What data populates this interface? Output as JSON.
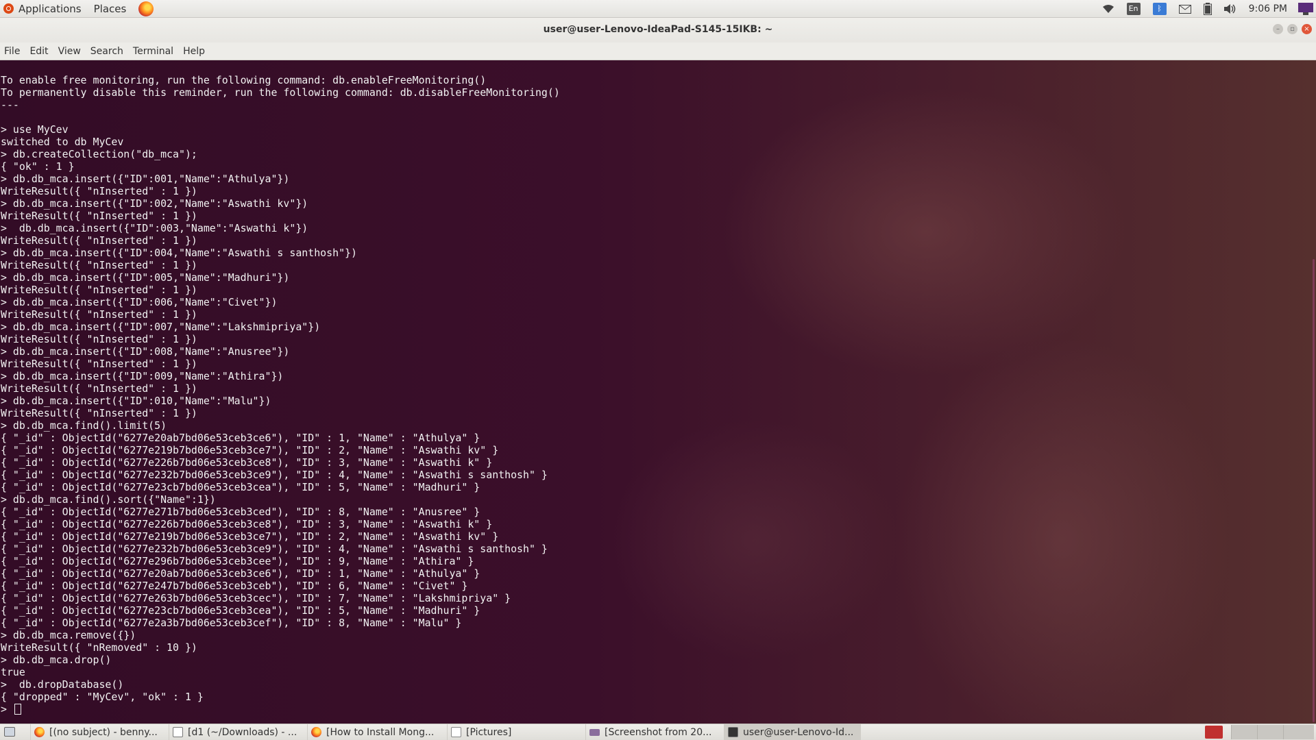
{
  "top_panel": {
    "applications_label": "Applications",
    "places_label": "Places",
    "tray": {
      "wifi_icon": "wifi-icon",
      "keyboard_layout": "En",
      "bluetooth_icon": "bluetooth-icon",
      "mail_icon": "mail-icon",
      "battery_icon": "battery-icon",
      "volume_icon": "volume-icon",
      "clock": "9:06 PM"
    }
  },
  "window": {
    "title": "user@user-Lenovo-IdeaPad-S145-15IKB: ~"
  },
  "menubar": {
    "items": [
      "File",
      "Edit",
      "View",
      "Search",
      "Terminal",
      "Help"
    ]
  },
  "terminal": {
    "lines": [
      "To enable free monitoring, run the following command: db.enableFreeMonitoring()",
      "To permanently disable this reminder, run the following command: db.disableFreeMonitoring()",
      "---",
      "",
      "> use MyCev",
      "switched to db MyCev",
      "> db.createCollection(\"db_mca\");",
      "{ \"ok\" : 1 }",
      "> db.db_mca.insert({\"ID\":001,\"Name\":\"Athulya\"})",
      "WriteResult({ \"nInserted\" : 1 })",
      "> db.db_mca.insert({\"ID\":002,\"Name\":\"Aswathi kv\"})",
      "WriteResult({ \"nInserted\" : 1 })",
      ">  db.db_mca.insert({\"ID\":003,\"Name\":\"Aswathi k\"})",
      "WriteResult({ \"nInserted\" : 1 })",
      "> db.db_mca.insert({\"ID\":004,\"Name\":\"Aswathi s santhosh\"})",
      "WriteResult({ \"nInserted\" : 1 })",
      "> db.db_mca.insert({\"ID\":005,\"Name\":\"Madhuri\"})",
      "WriteResult({ \"nInserted\" : 1 })",
      "> db.db_mca.insert({\"ID\":006,\"Name\":\"Civet\"})",
      "WriteResult({ \"nInserted\" : 1 })",
      "> db.db_mca.insert({\"ID\":007,\"Name\":\"Lakshmipriya\"})",
      "WriteResult({ \"nInserted\" : 1 })",
      "> db.db_mca.insert({\"ID\":008,\"Name\":\"Anusree\"})",
      "WriteResult({ \"nInserted\" : 1 })",
      "> db.db_mca.insert({\"ID\":009,\"Name\":\"Athira\"})",
      "WriteResult({ \"nInserted\" : 1 })",
      "> db.db_mca.insert({\"ID\":010,\"Name\":\"Malu\"})",
      "WriteResult({ \"nInserted\" : 1 })",
      "> db.db_mca.find().limit(5)",
      "{ \"_id\" : ObjectId(\"6277e20ab7bd06e53ceb3ce6\"), \"ID\" : 1, \"Name\" : \"Athulya\" }",
      "{ \"_id\" : ObjectId(\"6277e219b7bd06e53ceb3ce7\"), \"ID\" : 2, \"Name\" : \"Aswathi kv\" }",
      "{ \"_id\" : ObjectId(\"6277e226b7bd06e53ceb3ce8\"), \"ID\" : 3, \"Name\" : \"Aswathi k\" }",
      "{ \"_id\" : ObjectId(\"6277e232b7bd06e53ceb3ce9\"), \"ID\" : 4, \"Name\" : \"Aswathi s santhosh\" }",
      "{ \"_id\" : ObjectId(\"6277e23cb7bd06e53ceb3cea\"), \"ID\" : 5, \"Name\" : \"Madhuri\" }",
      "> db.db_mca.find().sort({\"Name\":1})",
      "{ \"_id\" : ObjectId(\"6277e271b7bd06e53ceb3ced\"), \"ID\" : 8, \"Name\" : \"Anusree\" }",
      "{ \"_id\" : ObjectId(\"6277e226b7bd06e53ceb3ce8\"), \"ID\" : 3, \"Name\" : \"Aswathi k\" }",
      "{ \"_id\" : ObjectId(\"6277e219b7bd06e53ceb3ce7\"), \"ID\" : 2, \"Name\" : \"Aswathi kv\" }",
      "{ \"_id\" : ObjectId(\"6277e232b7bd06e53ceb3ce9\"), \"ID\" : 4, \"Name\" : \"Aswathi s santhosh\" }",
      "{ \"_id\" : ObjectId(\"6277e296b7bd06e53ceb3cee\"), \"ID\" : 9, \"Name\" : \"Athira\" }",
      "{ \"_id\" : ObjectId(\"6277e20ab7bd06e53ceb3ce6\"), \"ID\" : 1, \"Name\" : \"Athulya\" }",
      "{ \"_id\" : ObjectId(\"6277e247b7bd06e53ceb3ceb\"), \"ID\" : 6, \"Name\" : \"Civet\" }",
      "{ \"_id\" : ObjectId(\"6277e263b7bd06e53ceb3cec\"), \"ID\" : 7, \"Name\" : \"Lakshmipriya\" }",
      "{ \"_id\" : ObjectId(\"6277e23cb7bd06e53ceb3cea\"), \"ID\" : 5, \"Name\" : \"Madhuri\" }",
      "{ \"_id\" : ObjectId(\"6277e2a3b7bd06e53ceb3cef\"), \"ID\" : 8, \"Name\" : \"Malu\" }",
      "> db.db_mca.remove({})",
      "WriteResult({ \"nRemoved\" : 10 })",
      "> db.db_mca.drop()",
      "true",
      ">  db.dropDatabase()",
      "{ \"dropped\" : \"MyCev\", \"ok\" : 1 }"
    ],
    "prompt": "> "
  },
  "taskbar": {
    "tasks": [
      {
        "label": "[(no subject) - benny...",
        "icon": "firefox-icon"
      },
      {
        "label": "[d1 (~/Downloads) - ...",
        "icon": "text-editor-icon"
      },
      {
        "label": "[How to Install Mong...",
        "icon": "firefox-icon"
      },
      {
        "label": "[Pictures]",
        "icon": "folder-icon"
      },
      {
        "label": "[Screenshot from 20...",
        "icon": "image-viewer-icon"
      },
      {
        "label": "user@user-Lenovo-Id...",
        "icon": "terminal-icon"
      }
    ]
  }
}
